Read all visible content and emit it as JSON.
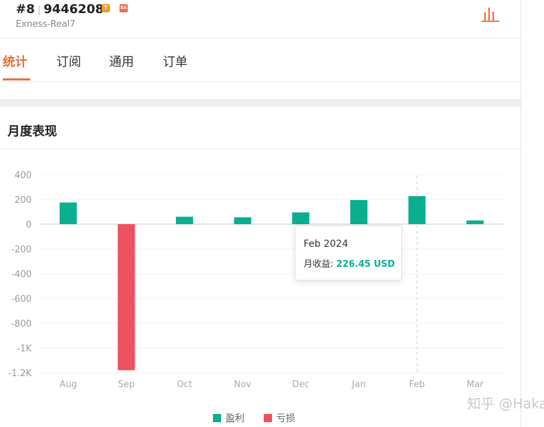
{
  "account": {
    "rank": "#8",
    "id": "9446208",
    "badge_t": "T",
    "badge_ea": "EA",
    "server": "Exness-Real7"
  },
  "icons": {
    "chart": "bar-chart-icon"
  },
  "tabs": [
    {
      "label": "统计",
      "active": true
    },
    {
      "label": "订阅",
      "active": false
    },
    {
      "label": "通用",
      "active": false
    },
    {
      "label": "订单",
      "active": false
    }
  ],
  "section": {
    "title": "月度表现"
  },
  "colors": {
    "profit": "#0aaf8f",
    "loss": "#ee5161",
    "accent": "#e86f3b"
  },
  "chart_data": {
    "type": "bar",
    "categories": [
      "Aug",
      "Sep",
      "Oct",
      "Nov",
      "Dec",
      "Jan",
      "Feb",
      "Mar"
    ],
    "values": [
      175,
      -1180,
      60,
      55,
      95,
      195,
      226.45,
      30
    ],
    "ytick_labels": [
      "400",
      "200",
      "0",
      "-200",
      "-400",
      "-600",
      "-800",
      "-1K",
      "-1.2K"
    ],
    "yticks": [
      400,
      200,
      0,
      -200,
      -400,
      -600,
      -800,
      -1000,
      -1200
    ],
    "ylim": [
      -1200,
      400
    ],
    "highlighted": "Feb",
    "legend": [
      "盈利",
      "亏损"
    ],
    "legend_placement": "bottom-center",
    "grid": true
  },
  "tooltip": {
    "date": "Feb 2024",
    "label": "月收益:",
    "value": "226.45 USD"
  },
  "legend": {
    "profit": "盈利",
    "loss": "亏损"
  },
  "watermark": "知乎 @Haka"
}
